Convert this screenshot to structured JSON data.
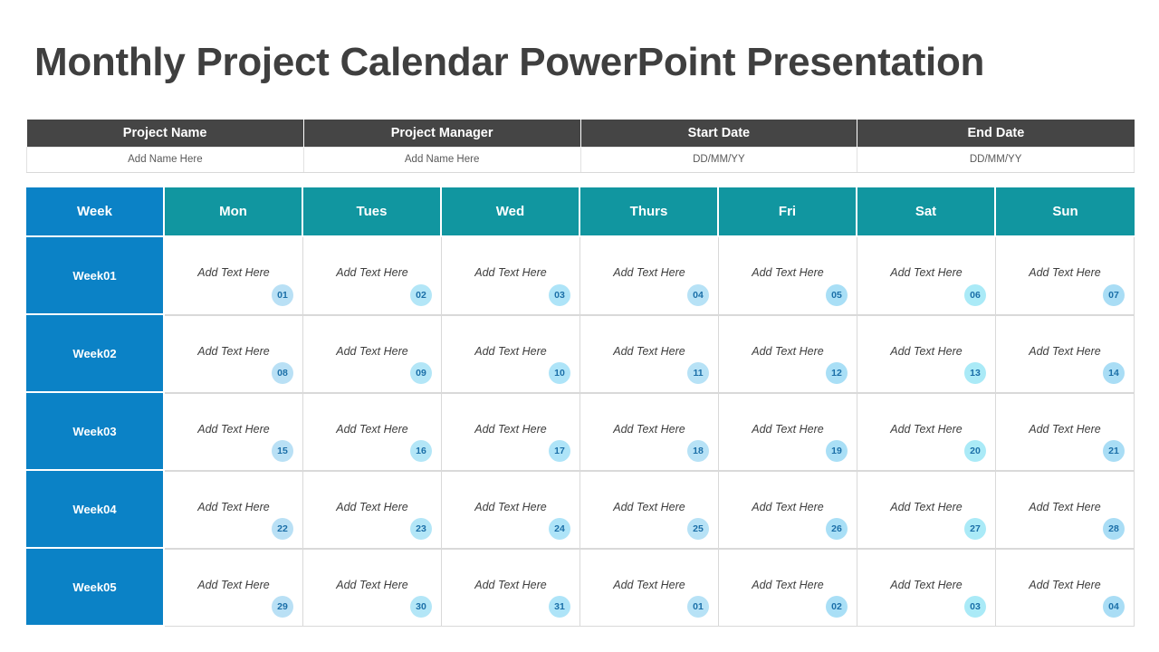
{
  "title": "Monthly Project Calendar PowerPoint Presentation",
  "colors": {
    "title_text": "#3f3f3f",
    "header_dark": "#454545",
    "week_blue": "#0b82c6",
    "day_teal": "#1196a0",
    "badge_text": "#1b6fa8"
  },
  "project_table": {
    "headers": [
      "Project Name",
      "Project Manager",
      "Start Date",
      "End Date"
    ],
    "values": [
      "Add Name Here",
      "Add Name Here",
      "DD/MM/YY",
      "DD/MM/YY"
    ]
  },
  "calendar": {
    "headers": [
      "Week",
      "Mon",
      "Tues",
      "Wed",
      "Thurs",
      "Fri",
      "Sat",
      "Sun"
    ],
    "cell_placeholder": "Add Text Here",
    "rows": [
      {
        "week_label": "Week01",
        "days": [
          {
            "text": "Add Text Here",
            "num": "01",
            "badge": "#b9e0f5"
          },
          {
            "text": "Add Text Here",
            "num": "02",
            "badge": "#b3e6f7"
          },
          {
            "text": "Add Text Here",
            "num": "03",
            "badge": "#aee4f8"
          },
          {
            "text": "Add Text Here",
            "num": "04",
            "badge": "#b7e2f6"
          },
          {
            "text": "Add Text Here",
            "num": "05",
            "badge": "#a9dff6"
          },
          {
            "text": "Add Text Here",
            "num": "06",
            "badge": "#aaeaf7"
          },
          {
            "text": "Add Text Here",
            "num": "07",
            "badge": "#a9ddf5"
          }
        ]
      },
      {
        "week_label": "Week02",
        "days": [
          {
            "text": "Add Text Here",
            "num": "08",
            "badge": "#b9e0f5"
          },
          {
            "text": "Add Text Here",
            "num": "09",
            "badge": "#b3e6f7"
          },
          {
            "text": "Add Text Here",
            "num": "10",
            "badge": "#aee4f8"
          },
          {
            "text": "Add Text Here",
            "num": "11",
            "badge": "#b7e2f6"
          },
          {
            "text": "Add Text Here",
            "num": "12",
            "badge": "#a9dff6"
          },
          {
            "text": "Add Text Here",
            "num": "13",
            "badge": "#aaeaf7"
          },
          {
            "text": "Add Text Here",
            "num": "14",
            "badge": "#a9ddf5"
          }
        ]
      },
      {
        "week_label": "Week03",
        "days": [
          {
            "text": "Add Text Here",
            "num": "15",
            "badge": "#b9e0f5"
          },
          {
            "text": "Add Text Here",
            "num": "16",
            "badge": "#b3e6f7"
          },
          {
            "text": "Add Text Here",
            "num": "17",
            "badge": "#aee4f8"
          },
          {
            "text": "Add Text Here",
            "num": "18",
            "badge": "#b7e2f6"
          },
          {
            "text": "Add Text Here",
            "num": "19",
            "badge": "#a9dff6"
          },
          {
            "text": "Add Text Here",
            "num": "20",
            "badge": "#aaeaf7"
          },
          {
            "text": "Add Text Here",
            "num": "21",
            "badge": "#a9ddf5"
          }
        ]
      },
      {
        "week_label": "Week04",
        "days": [
          {
            "text": "Add Text Here",
            "num": "22",
            "badge": "#b9e0f5"
          },
          {
            "text": "Add Text Here",
            "num": "23",
            "badge": "#b3e6f7"
          },
          {
            "text": "Add Text Here",
            "num": "24",
            "badge": "#aee4f8"
          },
          {
            "text": "Add Text Here",
            "num": "25",
            "badge": "#b7e2f6"
          },
          {
            "text": "Add Text Here",
            "num": "26",
            "badge": "#a9dff6"
          },
          {
            "text": "Add Text Here",
            "num": "27",
            "badge": "#aaeaf7"
          },
          {
            "text": "Add Text Here",
            "num": "28",
            "badge": "#a9ddf5"
          }
        ]
      },
      {
        "week_label": "Week05",
        "days": [
          {
            "text": "Add Text Here",
            "num": "29",
            "badge": "#b9e0f5"
          },
          {
            "text": "Add Text Here",
            "num": "30",
            "badge": "#b3e6f7"
          },
          {
            "text": "Add Text Here",
            "num": "31",
            "badge": "#aee4f8"
          },
          {
            "text": "Add Text Here",
            "num": "01",
            "badge": "#b7e2f6"
          },
          {
            "text": "Add Text Here",
            "num": "02",
            "badge": "#a9dff6"
          },
          {
            "text": "Add Text Here",
            "num": "03",
            "badge": "#aaeaf7"
          },
          {
            "text": "Add Text Here",
            "num": "04",
            "badge": "#a9ddf5"
          }
        ]
      }
    ]
  }
}
